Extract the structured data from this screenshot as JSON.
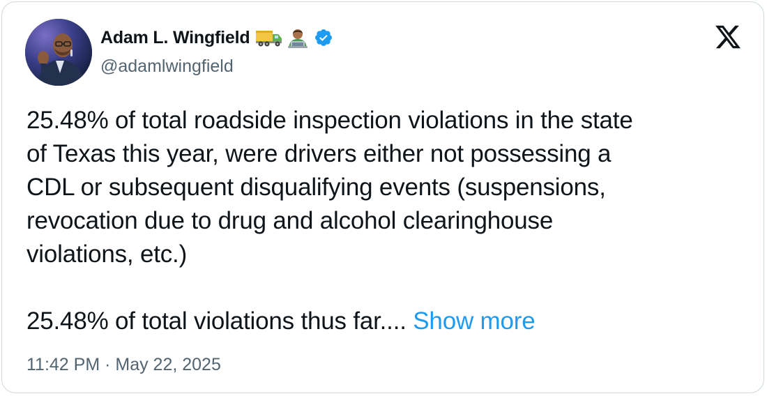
{
  "author": {
    "display_name": "Adam L. Wingfield",
    "emoji": [
      "delivery-truck-emoji",
      "technologist-emoji"
    ],
    "verified": true,
    "handle": "@adamlwingfield"
  },
  "tweet": {
    "paragraph_1": "25.48% of total roadside inspection violations in the state\nof Texas this year, were drivers either not possessing a\nCDL or subsequent disqualifying events (suspensions,\nrevocation due to drug and alcohol clearinghouse\nviolations, etc.)",
    "paragraph_2": "25.48% of total violations thus far.... ",
    "show_more_label": "Show more"
  },
  "meta": {
    "timestamp": "11:42 PM · May 22, 2025"
  },
  "icons": {
    "platform_logo": "x-logo-icon",
    "verified_badge": "verified-badge-icon"
  },
  "colors": {
    "text_primary": "#0f1419",
    "text_secondary": "#536471",
    "link": "#1d9bf0",
    "verified": "#1d9bf0",
    "border": "#cfd9de"
  }
}
